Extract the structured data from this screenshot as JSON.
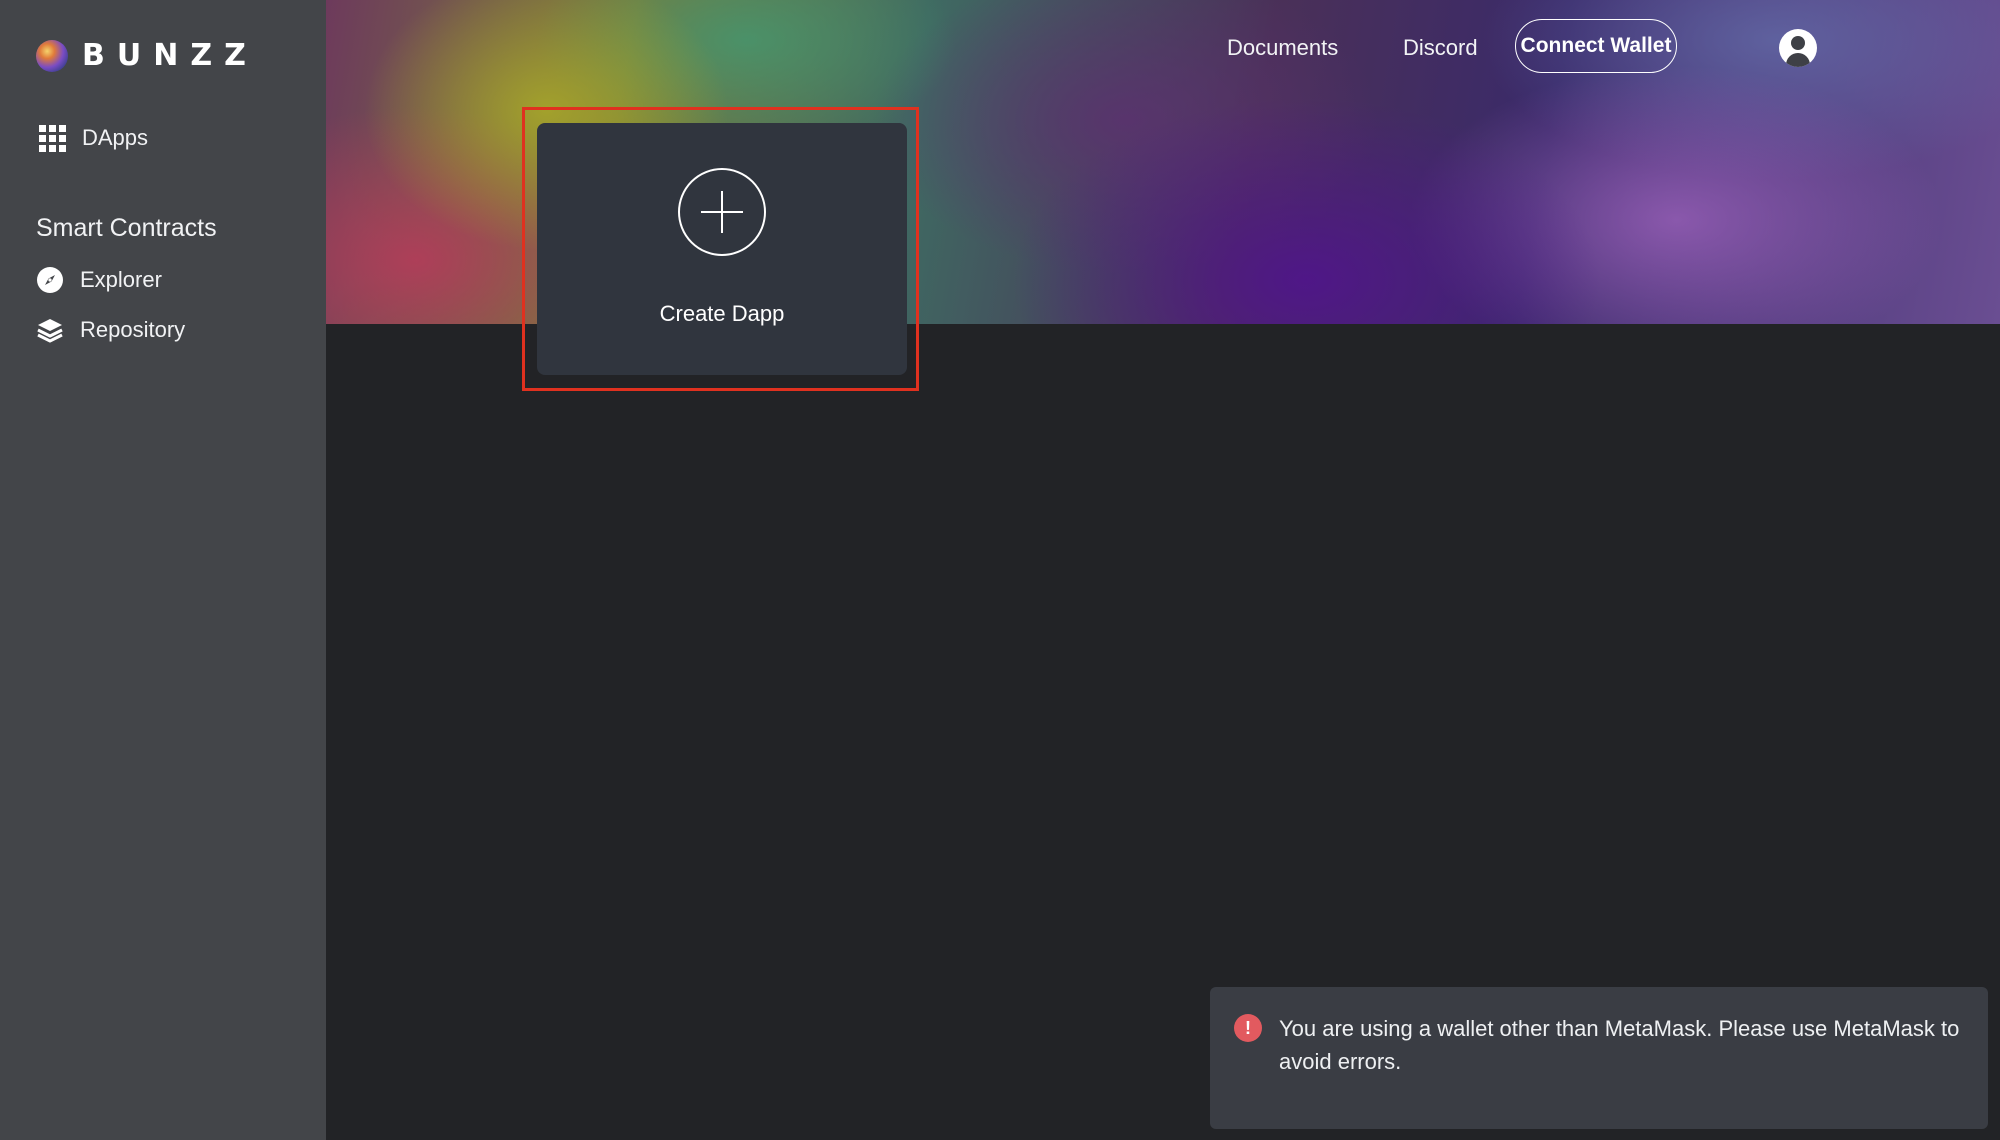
{
  "brand": {
    "name": "BUNZZ"
  },
  "sidebar": {
    "items": [
      {
        "label": "DApps",
        "icon": "grid-icon"
      }
    ],
    "section_title": "Smart Contracts",
    "section_items": [
      {
        "label": "Explorer",
        "icon": "compass-icon"
      },
      {
        "label": "Repository",
        "icon": "layers-icon"
      }
    ]
  },
  "top_nav": {
    "links": [
      "Documents",
      "Discord"
    ],
    "connect_wallet_label": "Connect Wallet",
    "account_icon": "user-circle-icon"
  },
  "main": {
    "create_card": {
      "label": "Create Dapp",
      "icon": "plus-circle-icon"
    }
  },
  "toast": {
    "icon": "alert-circle-icon",
    "icon_glyph": "!",
    "message": "You are using a wallet other than MetaMask. Please use MetaMask to avoid errors."
  },
  "colors": {
    "sidebar_bg": "#434549",
    "main_bg": "#222326",
    "card_bg": "#30353e",
    "highlight": "#e0311f",
    "alert": "#e25a5f"
  }
}
